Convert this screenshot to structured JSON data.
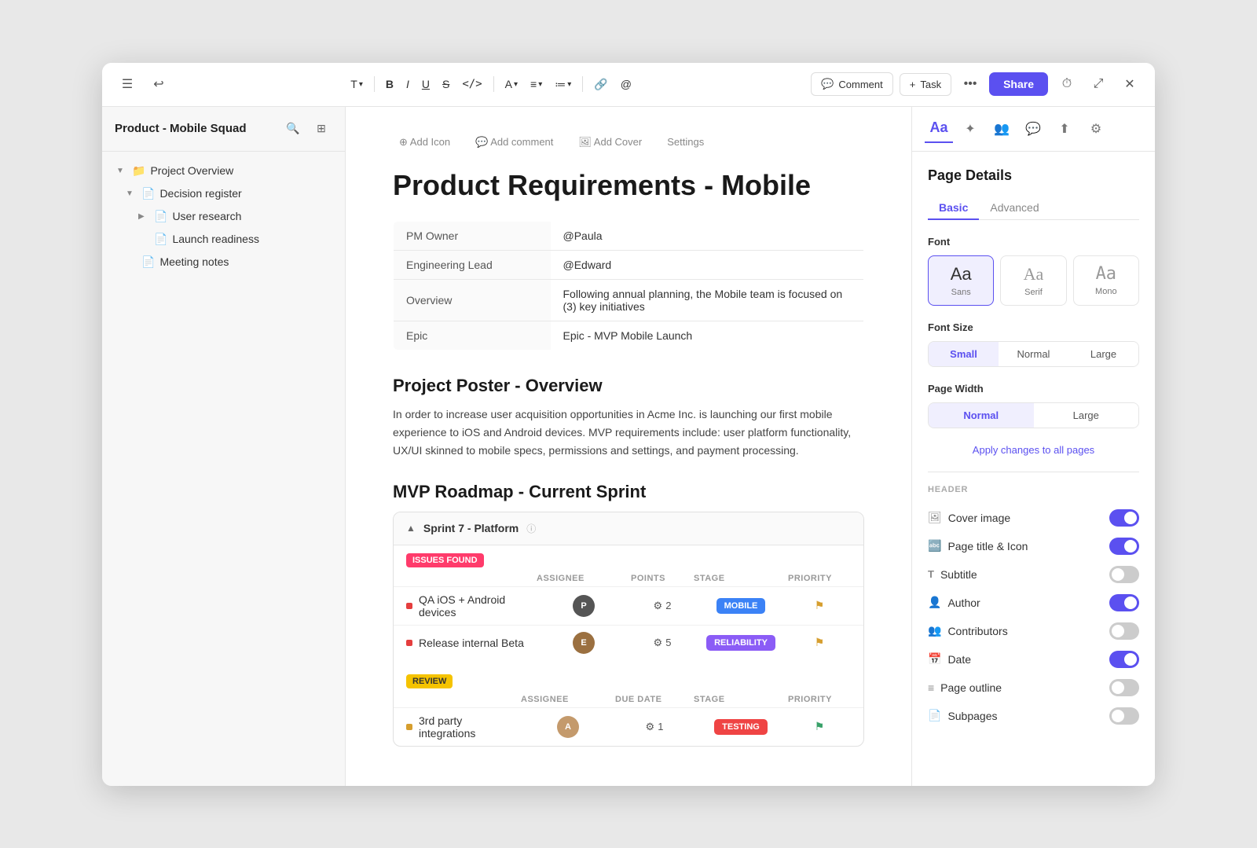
{
  "window": {
    "title": "Product - Mobile Squad"
  },
  "toolbar": {
    "undo_icon": "↩",
    "hamburger_icon": "☰",
    "text_label": "T",
    "bold_label": "B",
    "italic_label": "I",
    "underline_label": "U",
    "strikethrough_label": "S",
    "code_label": "</>",
    "font_color_label": "A",
    "align_label": "≡",
    "list_label": "≔",
    "link_label": "🔗",
    "mention_label": "@",
    "comment_label": "Comment",
    "task_label": "Task",
    "more_label": "...",
    "history_icon": "⏱",
    "expand_icon": "⤢",
    "close_icon": "✕",
    "share_label": "Share"
  },
  "sidebar": {
    "title": "Product - Mobile Squad",
    "search_icon": "🔍",
    "layout_icon": "⊞",
    "items": [
      {
        "label": "Project Overview",
        "indent": 0,
        "has_arrow": true,
        "expanded": true,
        "icon": "📁"
      },
      {
        "label": "Decision register",
        "indent": 1,
        "has_arrow": true,
        "expanded": true,
        "icon": "📄"
      },
      {
        "label": "User research",
        "indent": 2,
        "has_arrow": true,
        "expanded": false,
        "icon": "📄"
      },
      {
        "label": "Launch readiness",
        "indent": 2,
        "has_arrow": false,
        "expanded": false,
        "icon": "📄"
      },
      {
        "label": "Meeting notes",
        "indent": 1,
        "has_arrow": false,
        "expanded": false,
        "icon": "📄"
      }
    ]
  },
  "editor": {
    "page_actions": [
      {
        "label": "Add Icon",
        "icon": "⊕"
      },
      {
        "label": "Add comment",
        "icon": "💬"
      },
      {
        "label": "Add Cover",
        "icon": "🖼"
      },
      {
        "label": "Settings",
        "icon": ""
      }
    ],
    "page_title": "Product Requirements - Mobile",
    "info_table": [
      {
        "key": "PM Owner",
        "value": "@Paula"
      },
      {
        "key": "Engineering Lead",
        "value": "@Edward"
      },
      {
        "key": "Overview",
        "value": "Following annual planning, the Mobile team is focused on (3) key initiatives"
      },
      {
        "key": "Epic",
        "value": "Epic - MVP Mobile Launch"
      }
    ],
    "section1_heading": "Project Poster - Overview",
    "section1_text": "In order to increase user acquisition opportunities in Acme Inc. is launching our first mobile experience to iOS and Android devices. MVP requirements include: user platform functionality, UX/UI skinned to mobile specs, permissions and settings, and payment processing.",
    "section2_heading": "MVP Roadmap - Current Sprint",
    "sprint": {
      "label": "Sprint  7 - Platform",
      "groups": [
        {
          "tag": "ISSUES FOUND",
          "tag_class": "issues-found",
          "columns": [
            "ASSIGNEE",
            "POINTS",
            "STAGE",
            "PRIORITY"
          ],
          "rows": [
            {
              "dot_class": "red",
              "label": "QA iOS + Android devices",
              "avatar_bg": "#555",
              "avatar_initials": "P",
              "points": "2",
              "stage": "MOBILE",
              "stage_class": "mobile",
              "flag_class": "flag-yellow"
            },
            {
              "dot_class": "red",
              "label": "Release internal Beta",
              "avatar_bg": "#9b7040",
              "avatar_initials": "E",
              "points": "5",
              "stage": "RELIABILITY",
              "stage_class": "reliability",
              "flag_class": "flag-yellow"
            }
          ]
        },
        {
          "tag": "REVIEW",
          "tag_class": "review",
          "columns": [
            "ASSIGNEE",
            "DUE DATE",
            "STAGE",
            "PRIORITY"
          ],
          "rows": [
            {
              "dot_class": "yellow",
              "label": "3rd party integrations",
              "avatar_bg": "#c49a6c",
              "avatar_initials": "A",
              "points": "1",
              "stage": "TESTING",
              "stage_class": "testing",
              "flag_class": "flag-green"
            }
          ]
        }
      ]
    }
  },
  "right_panel": {
    "icons": [
      "Aa",
      "✦",
      "👥",
      "💬",
      "⬆",
      "⚙"
    ],
    "section_title": "Page Details",
    "tabs": [
      "Basic",
      "Advanced"
    ],
    "font": {
      "label": "Font",
      "options": [
        "Sans",
        "Serif",
        "Mono"
      ]
    },
    "font_size": {
      "label": "Font Size",
      "options": [
        "Small",
        "Normal",
        "Large"
      ],
      "selected": "Small"
    },
    "page_width": {
      "label": "Page Width",
      "options": [
        "Normal",
        "Large"
      ],
      "selected": "Normal"
    },
    "apply_all": "Apply changes to all pages",
    "header_label": "HEADER",
    "toggles": [
      {
        "label": "Cover image",
        "icon": "🖼",
        "state": "on"
      },
      {
        "label": "Page title & Icon",
        "icon": "🔤",
        "state": "on"
      },
      {
        "label": "Subtitle",
        "icon": "T",
        "state": "off"
      },
      {
        "label": "Author",
        "icon": "👤",
        "state": "on"
      },
      {
        "label": "Contributors",
        "icon": "👥",
        "state": "off"
      },
      {
        "label": "Date",
        "icon": "📅",
        "state": "on"
      },
      {
        "label": "Page outline",
        "icon": "≡",
        "state": "off"
      },
      {
        "label": "Subpages",
        "icon": "📄",
        "state": "off"
      }
    ]
  }
}
